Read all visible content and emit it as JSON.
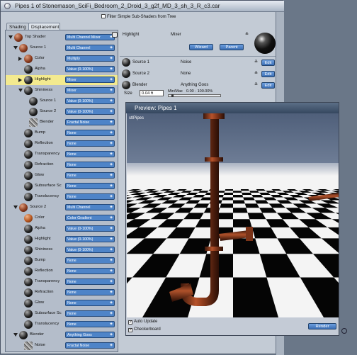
{
  "window": {
    "title": "Pipes 1 of Stonemason_SciFi_Bedroom_2_Droid_3_g2f_MD_3_sh_3_R_c3.car",
    "filter_label": "Filter Simple Sub-Shaders from Tree",
    "filter_checked": false
  },
  "tabs": [
    "Shading",
    "Displacement"
  ],
  "tree": [
    {
      "label": "Top Shader",
      "value": "Multi Channel Mixer",
      "indent": 0,
      "icon": "rust",
      "expand": "down"
    },
    {
      "label": "Source 1",
      "value": "Multi Channel",
      "indent": 1,
      "icon": "rust",
      "expand": "down"
    },
    {
      "label": "Color",
      "value": "Multiply",
      "indent": 2,
      "icon": "rust",
      "expand": "right"
    },
    {
      "label": "Alpha",
      "value": "Value (0-100%)",
      "indent": 2,
      "icon": "black",
      "expand": ""
    },
    {
      "label": "Highlight",
      "value": "Mixer",
      "indent": 2,
      "icon": "black",
      "expand": "right",
      "highlighted": true
    },
    {
      "label": "Shininess",
      "value": "Mixer",
      "indent": 2,
      "icon": "black",
      "expand": "down"
    },
    {
      "label": "Source 1",
      "value": "Value (0-100%)",
      "indent": 3,
      "icon": "black",
      "expand": ""
    },
    {
      "label": "Source 2",
      "value": "Value (0-100%)",
      "indent": 3,
      "icon": "black",
      "expand": ""
    },
    {
      "label": "Blender",
      "value": "Fractal Noise",
      "indent": 3,
      "icon": "noise",
      "expand": ""
    },
    {
      "label": "Bump",
      "value": "None",
      "indent": 2,
      "icon": "black",
      "expand": ""
    },
    {
      "label": "Reflection",
      "value": "None",
      "indent": 2,
      "icon": "black",
      "expand": ""
    },
    {
      "label": "Transparency",
      "value": "None",
      "indent": 2,
      "icon": "black",
      "expand": ""
    },
    {
      "label": "Refraction",
      "value": "None",
      "indent": 2,
      "icon": "black",
      "expand": ""
    },
    {
      "label": "Glow",
      "value": "None",
      "indent": 2,
      "icon": "black",
      "expand": ""
    },
    {
      "label": "Subsurface Sc",
      "value": "None",
      "indent": 2,
      "icon": "black",
      "expand": ""
    },
    {
      "label": "Translucency",
      "value": "None",
      "indent": 2,
      "icon": "black",
      "expand": ""
    },
    {
      "label": "Source 2",
      "value": "Multi Channel",
      "indent": 1,
      "icon": "rust",
      "expand": "down"
    },
    {
      "label": "Color",
      "value": "Color Gradient",
      "indent": 2,
      "icon": "orange",
      "expand": ""
    },
    {
      "label": "Alpha",
      "value": "Value (0-100%)",
      "indent": 2,
      "icon": "black",
      "expand": ""
    },
    {
      "label": "Highlight",
      "value": "Value (0-100%)",
      "indent": 2,
      "icon": "black",
      "expand": ""
    },
    {
      "label": "Shininess",
      "value": "Value (0-100%)",
      "indent": 2,
      "icon": "black",
      "expand": ""
    },
    {
      "label": "Bump",
      "value": "None",
      "indent": 2,
      "icon": "black",
      "expand": ""
    },
    {
      "label": "Reflection",
      "value": "None",
      "indent": 2,
      "icon": "black",
      "expand": ""
    },
    {
      "label": "Transparency",
      "value": "None",
      "indent": 2,
      "icon": "black",
      "expand": ""
    },
    {
      "label": "Refraction",
      "value": "None",
      "indent": 2,
      "icon": "black",
      "expand": ""
    },
    {
      "label": "Glow",
      "value": "None",
      "indent": 2,
      "icon": "black",
      "expand": ""
    },
    {
      "label": "Subsurface Sc",
      "value": "None",
      "indent": 2,
      "icon": "black",
      "expand": ""
    },
    {
      "label": "Translucency",
      "value": "None",
      "indent": 2,
      "icon": "black",
      "expand": ""
    },
    {
      "label": "Blender",
      "value": "Anything Goos",
      "indent": 1,
      "icon": "black",
      "expand": "down"
    },
    {
      "label": "Noise",
      "value": "Fractal Noise",
      "indent": 2,
      "icon": "noise",
      "expand": ""
    }
  ],
  "detail": {
    "name": "Highlight",
    "type": "Mixer",
    "wizard": "Wizard",
    "parent": "Parent",
    "rows": [
      {
        "label": "Source 1",
        "value": "Noise",
        "edit": "Edit"
      },
      {
        "label": "Source 2",
        "value": "None",
        "edit": "Edit"
      },
      {
        "label": "Blender",
        "value": "Anything Goos",
        "edit": "Edit"
      }
    ],
    "size_label": "Size",
    "size_value": "0.04 ft",
    "minmax_label": "Min/Max",
    "minmax_range": "0.00 - 100.00%"
  },
  "preview": {
    "title": "Preview: Pipes 1",
    "scene_label": "stlPipes",
    "auto_update": "Auto Update",
    "checkerboard": "Checkerboard",
    "render": "Render"
  }
}
